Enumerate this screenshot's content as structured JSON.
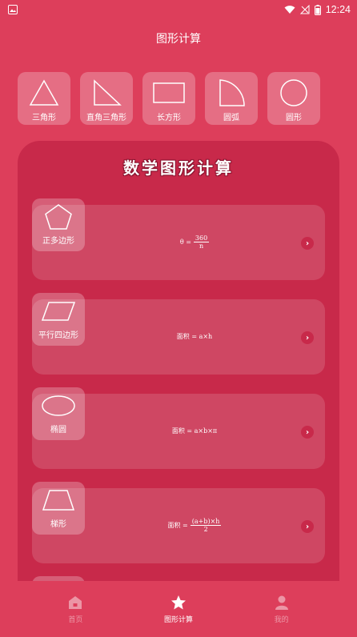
{
  "status_bar": {
    "time": "12:24"
  },
  "header": {
    "title": "图形计算"
  },
  "shape_chips": [
    {
      "label": "三角形",
      "icon": "triangle-icon"
    },
    {
      "label": "直角三角形",
      "icon": "right-triangle-icon"
    },
    {
      "label": "长方形",
      "icon": "rectangle-icon"
    },
    {
      "label": "圆弧",
      "icon": "arc-icon"
    },
    {
      "label": "圆形",
      "icon": "circle-icon"
    }
  ],
  "panel": {
    "title": "数学图形计算",
    "cards": [
      {
        "label": "正多边形",
        "icon": "pentagon-icon",
        "formula_lhs": "θ =",
        "formula_num": "360",
        "formula_den": "n",
        "formula_rest": ""
      },
      {
        "label": "平行四边形",
        "icon": "parallelogram-icon",
        "formula_lhs": "面积 = a×h",
        "formula_num": "",
        "formula_den": "",
        "formula_rest": ""
      },
      {
        "label": "椭圆",
        "icon": "ellipse-icon",
        "formula_lhs": "面积 = a×b×π",
        "formula_num": "",
        "formula_den": "",
        "formula_rest": ""
      },
      {
        "label": "梯形",
        "icon": "trapezoid-icon",
        "formula_lhs": "面积 =",
        "formula_num": "(a+b)×h",
        "formula_den": "2",
        "formula_rest": ""
      }
    ],
    "arrow": "›"
  },
  "bottom_nav": [
    {
      "label": "首页",
      "icon": "home-icon",
      "active": false
    },
    {
      "label": "图形计算",
      "icon": "star-icon",
      "active": true
    },
    {
      "label": "我的",
      "icon": "user-icon",
      "active": false
    }
  ],
  "colors": {
    "background": "#dd3e5b",
    "panel": "#c8294a"
  }
}
